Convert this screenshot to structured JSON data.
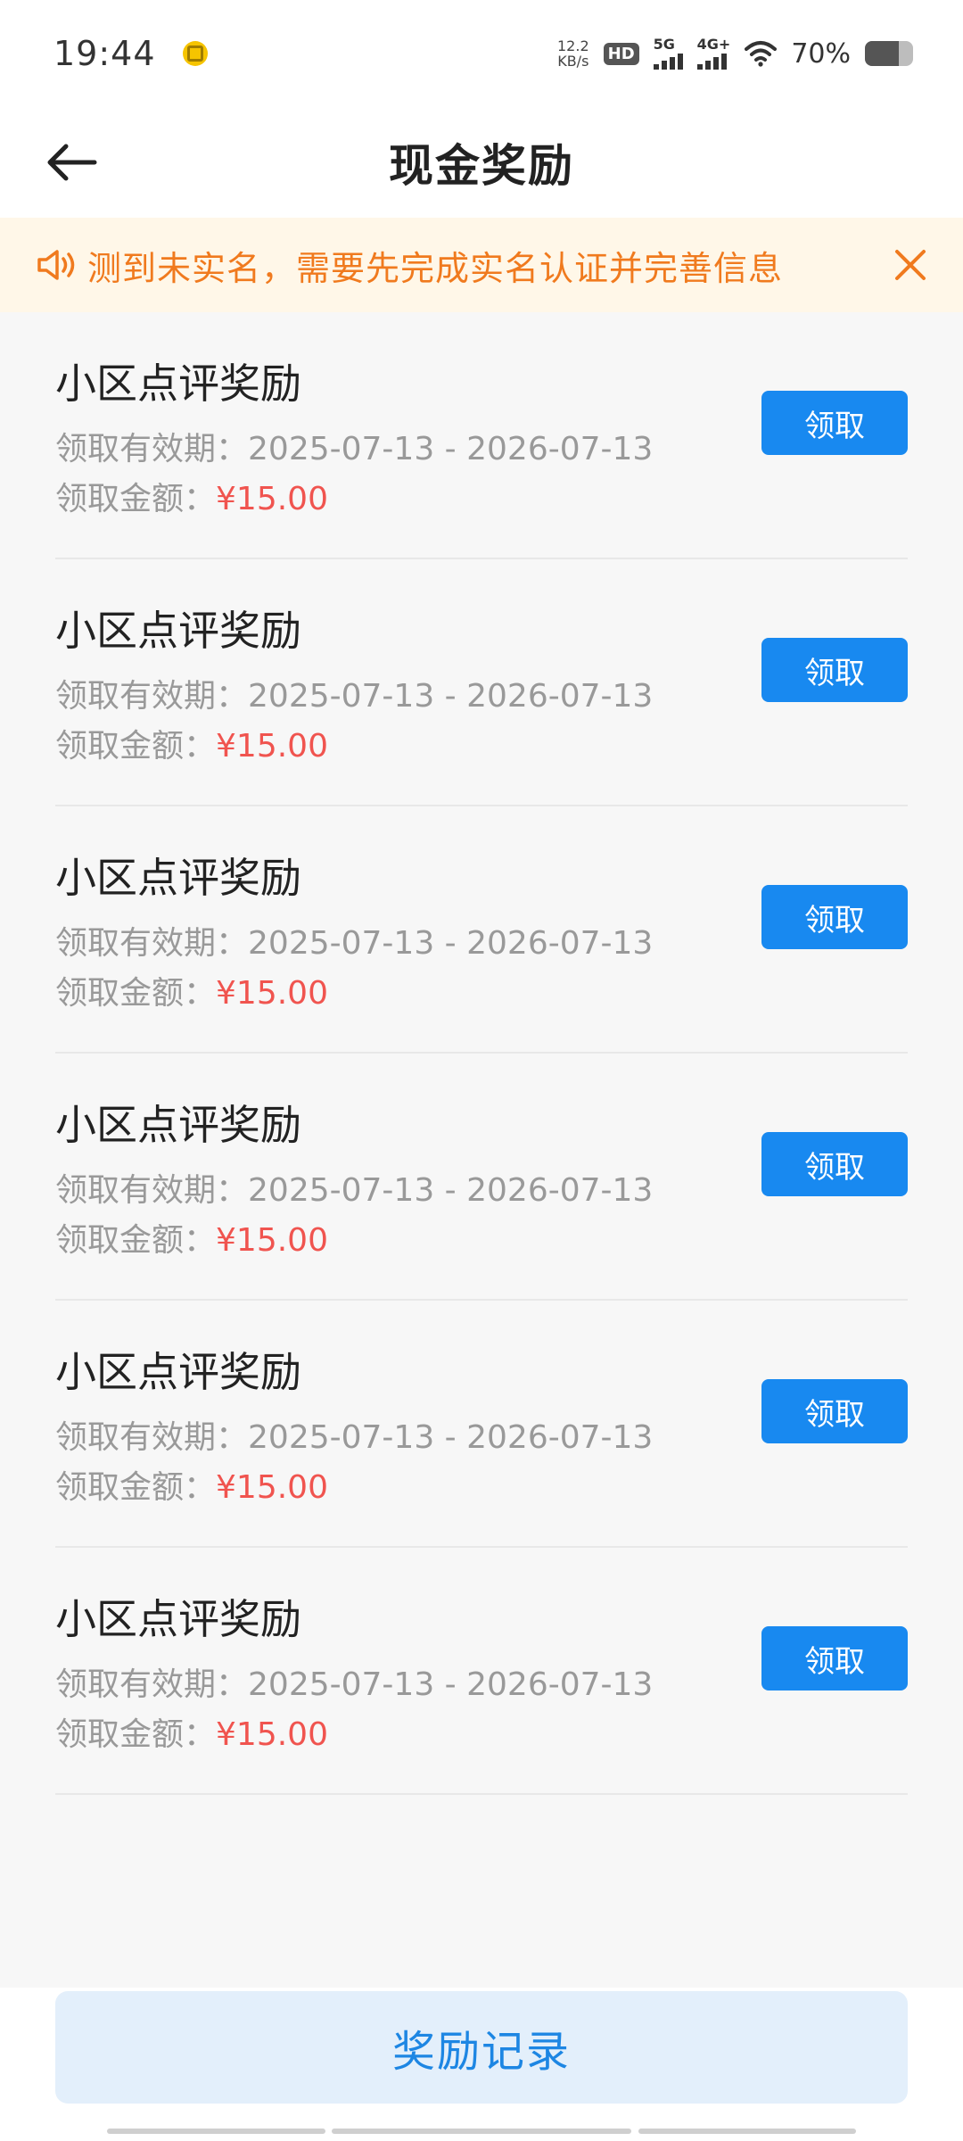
{
  "status_bar": {
    "time": "19:44",
    "net_speed_value": "12.2",
    "net_speed_unit": "KB/s",
    "hd_label": "HD",
    "sim1_label": "5G",
    "sim2_label": "4G+",
    "battery_percent_text": "70%",
    "battery_level": 0.7
  },
  "header": {
    "title": "现金奖励"
  },
  "notice": {
    "text": "测到未实名，需要先完成实名认证并完善信息",
    "color": "#f07a1e"
  },
  "rewards": [
    {
      "title": "小区点评奖励",
      "period_label": "领取有效期：",
      "period": "2025-07-13 - 2026-07-13",
      "amount_label": "领取金额：",
      "amount": "¥15.00",
      "button": "领取"
    },
    {
      "title": "小区点评奖励",
      "period_label": "领取有效期：",
      "period": "2025-07-13 - 2026-07-13",
      "amount_label": "领取金额：",
      "amount": "¥15.00",
      "button": "领取"
    },
    {
      "title": "小区点评奖励",
      "period_label": "领取有效期：",
      "period": "2025-07-13 - 2026-07-13",
      "amount_label": "领取金额：",
      "amount": "¥15.00",
      "button": "领取"
    },
    {
      "title": "小区点评奖励",
      "period_label": "领取有效期：",
      "period": "2025-07-13 - 2026-07-13",
      "amount_label": "领取金额：",
      "amount": "¥15.00",
      "button": "领取"
    },
    {
      "title": "小区点评奖励",
      "period_label": "领取有效期：",
      "period": "2025-07-13 - 2026-07-13",
      "amount_label": "领取金额：",
      "amount": "¥15.00",
      "button": "领取"
    },
    {
      "title": "小区点评奖励",
      "period_label": "领取有效期：",
      "period": "2025-07-13 - 2026-07-13",
      "amount_label": "领取金额：",
      "amount": "¥15.00",
      "button": "领取"
    }
  ],
  "footer": {
    "records_button": "奖励记录"
  },
  "icons": {
    "back": "arrow-left-icon",
    "speaker": "speaker-icon",
    "close": "close-icon",
    "wifi": "wifi-icon",
    "battery": "battery-icon"
  },
  "colors": {
    "primary": "#1889f0",
    "amount": "#f0544f",
    "notice_bg": "#fff7e8"
  }
}
